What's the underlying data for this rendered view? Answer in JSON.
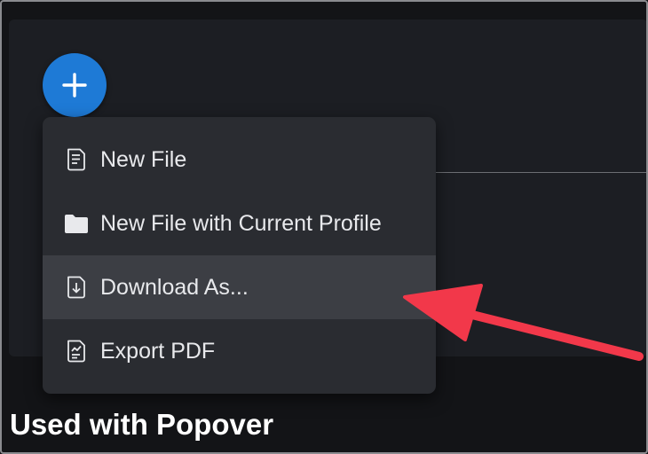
{
  "fab": {
    "icon": "plus-icon",
    "color": "#1e7ad6"
  },
  "menu": {
    "items": [
      {
        "label": "New File",
        "icon": "file-text-icon"
      },
      {
        "label": "New File with Current Profile",
        "icon": "folder-icon"
      },
      {
        "label": "Download As...",
        "icon": "file-download-icon",
        "active": true
      },
      {
        "label": "Export PDF",
        "icon": "file-chart-icon"
      }
    ]
  },
  "caption": "Used with Popover",
  "annotation": {
    "type": "arrow",
    "color": "#f2384a",
    "points_to": "Download As..."
  }
}
